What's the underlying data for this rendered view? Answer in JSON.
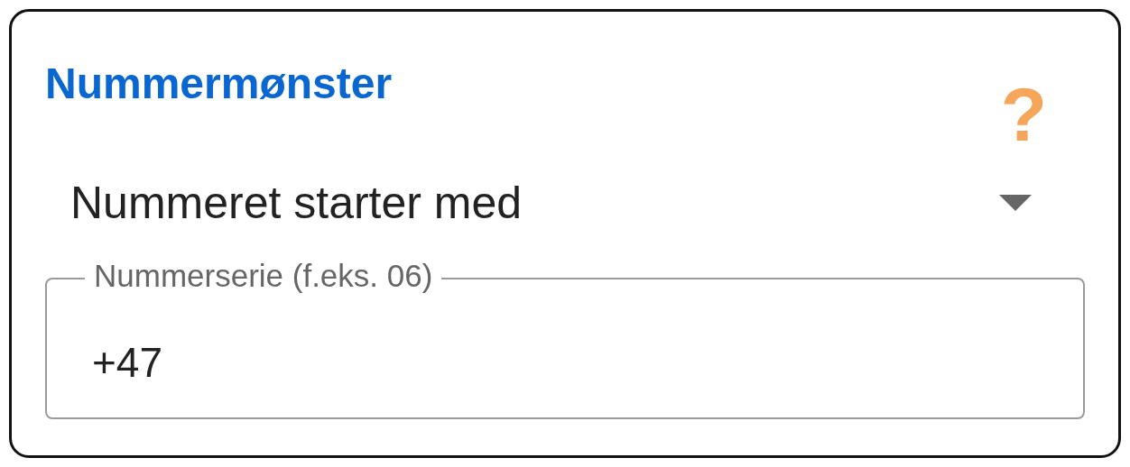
{
  "title": "Nummermønster",
  "help": "?",
  "select": {
    "value": "Nummeret starter med"
  },
  "field": {
    "label": "Nummerserie (f.eks. 06)",
    "value": "+47"
  }
}
